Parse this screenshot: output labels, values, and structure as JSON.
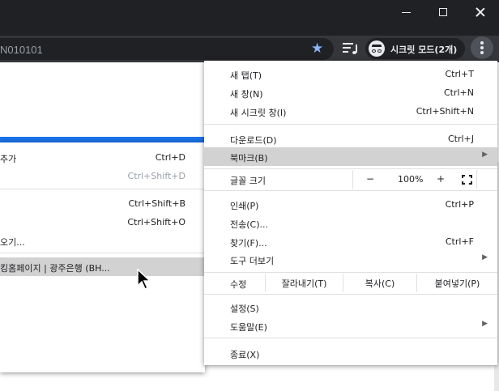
{
  "address_bar": {
    "url": "N010101"
  },
  "incognito": {
    "label": "시크릿 모드(2개)"
  },
  "main_menu": {
    "items": [
      {
        "label": "새 탭(T)",
        "shortcut": "Ctrl+T"
      },
      {
        "label": "새 창(N)",
        "shortcut": "Ctrl+N"
      },
      {
        "label": "새 시크릿 창(I)",
        "shortcut": "Ctrl+Shift+N"
      },
      {
        "label": "다운로드(D)",
        "shortcut": "Ctrl+J"
      },
      {
        "label": "북마크(B)",
        "shortcut": ""
      },
      {
        "label": "인쇄(P)",
        "shortcut": "Ctrl+P"
      },
      {
        "label": "전송(C)...",
        "shortcut": ""
      },
      {
        "label": "찾기(F)...",
        "shortcut": "Ctrl+F"
      },
      {
        "label": "도구 더보기",
        "shortcut": ""
      },
      {
        "label": "설정(S)",
        "shortcut": ""
      },
      {
        "label": "도움말(E)",
        "shortcut": ""
      },
      {
        "label": "종료(X)",
        "shortcut": ""
      }
    ],
    "zoom": {
      "label": "글꼴 크기",
      "minus": "−",
      "value": "100%",
      "plus": "+"
    },
    "edit": {
      "label": "수정",
      "cut": "잘라내기(T)",
      "copy": "복사(C)",
      "paste": "붙여넣기(P)"
    }
  },
  "bookmarks_menu": {
    "items": [
      {
        "label": "추가",
        "shortcut": "Ctrl+D"
      },
      {
        "label": "",
        "shortcut": "Ctrl+Shift+D"
      },
      {
        "label": "",
        "shortcut": "Ctrl+Shift+B"
      },
      {
        "label": "",
        "shortcut": "Ctrl+Shift+O"
      },
      {
        "label": "오기...",
        "shortcut": ""
      },
      {
        "label": "킹홈페이지 | 광주은행 (BH...",
        "shortcut": ""
      }
    ]
  }
}
